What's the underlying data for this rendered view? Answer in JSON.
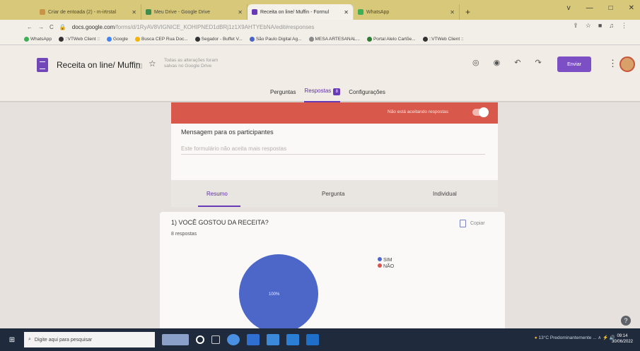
{
  "browser": {
    "tabs": [
      {
        "label": "Criar de entoada (2) - m-irtrstal",
        "color": "#c8944a"
      },
      {
        "label": "Meu Drive - Google Drive",
        "color": "#3e8d4c"
      },
      {
        "label": "Receita on line/ Muffin - Formul",
        "color": "#673ab7"
      },
      {
        "label": "WhatsApp",
        "color": "#3fae57"
      }
    ],
    "new_tab": "+",
    "window_controls": [
      "v",
      "—",
      "□",
      "✕"
    ],
    "nav": [
      "←",
      "→",
      "C"
    ],
    "url_host": "docs.google.com",
    "url_rest": "/forms/d/1RyAV8VIGNICE_KOHIPNED1dBRj1z1X9AHTYEbNA/edit#responses",
    "addr_icons": [
      "⇪",
      "☆",
      "■",
      "♫",
      "⋮"
    ],
    "bookmarks": [
      {
        "label": "WhatsApp",
        "color": "#3fae57"
      },
      {
        "label": "::VTWeb Client ::",
        "color": "#333333"
      },
      {
        "label": "Google",
        "color": "#4285f4"
      },
      {
        "label": "Busca CEP Rua Doc...",
        "color": "#f4b400"
      },
      {
        "label": "Segador - Buffet V...",
        "color": "#333333"
      },
      {
        "label": "São Paulo Digital Ag...",
        "color": "#4a63c7"
      },
      {
        "label": "MESA ARTESANAL...",
        "color": "#8a8a8a"
      },
      {
        "label": "Portal Alelo Cartõe...",
        "color": "#2e7d32"
      },
      {
        "label": "::VTWeb Client ::",
        "color": "#333333"
      }
    ]
  },
  "form": {
    "title": "Receita on line/ Muffin",
    "saved_note": "Todas as alterações foram salvas no Google Drive",
    "send_label": "Enviar",
    "header_icons": [
      "palette-icon",
      "eye-icon",
      "undo-icon",
      "redo-icon"
    ],
    "nav_tabs": {
      "questions": "Perguntas",
      "responses": "Respostas",
      "responses_count": "8",
      "settings": "Configurações"
    },
    "banner": {
      "text": "Não está aceitando respostas",
      "accepting": false
    },
    "message": {
      "label": "Mensagem para os participantes",
      "text": "Este formulário não aceita mais respostas"
    },
    "summary_tabs": {
      "summary": "Resumo",
      "question": "Pergunta",
      "individual": "Individual"
    },
    "question": {
      "title": "1) VOCÊ GOSTOU DA RECEITA?",
      "responses": "8 respostas",
      "copy_label": "Copiar"
    }
  },
  "chart_data": {
    "type": "pie",
    "categories": [
      "SIM",
      "NÃO"
    ],
    "values": [
      100,
      0
    ],
    "colors": [
      "#4d67c8",
      "#d9534f"
    ],
    "slice_label": "100%"
  },
  "taskbar": {
    "search_placeholder": "Digite aqui para pesquisar",
    "tray_text": "13°C Predominantemente ...",
    "time": "09:14",
    "date": "30/06/2022"
  }
}
